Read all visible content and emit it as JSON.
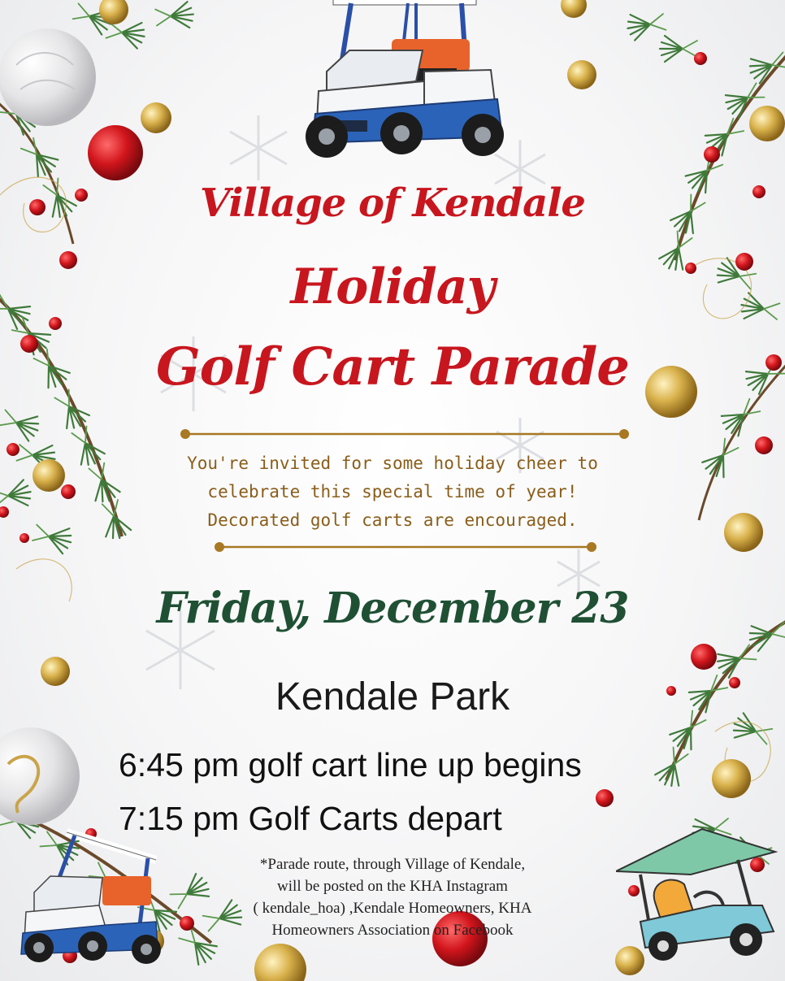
{
  "event": {
    "title_line1": "Village  of Kendale",
    "title_line2": "Holiday",
    "title_line3": "Golf Cart Parade",
    "invite_lines": [
      "You're invited for some holiday cheer to",
      "celebrate this special time of year!",
      "Decorated golf carts are encouraged."
    ],
    "date": "Friday, December 23",
    "venue": "Kendale Park",
    "times": [
      "6:45 pm golf cart line up begins",
      "7:15 pm Golf Carts depart"
    ],
    "note_lines": [
      "*Parade route, through Village of Kendale,",
      "will be posted on the KHA Instagram",
      "( kendale_hoa) ,Kendale Homeowners, KHA",
      "Homeowners Association on Facebook"
    ]
  },
  "colors": {
    "title_red": "#c8161e",
    "date_green": "#1f5034",
    "invite_gold": "#8a5d1a",
    "divider_gold": "#a87822"
  },
  "decor": {
    "icons": [
      "golf-cart-icon",
      "pine-branch-icon",
      "ornament-icon",
      "snowflake-icon"
    ]
  }
}
